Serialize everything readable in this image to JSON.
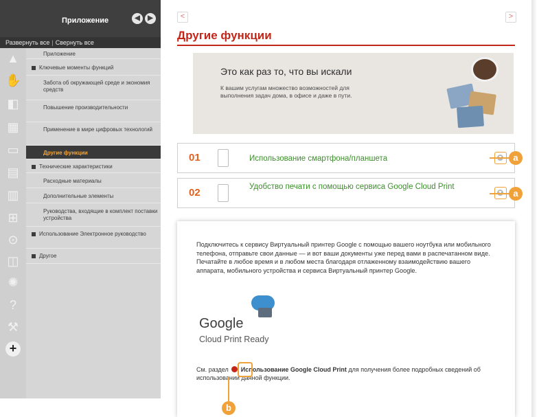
{
  "sidebar": {
    "title": "Приложение",
    "prev_icon": "◀",
    "next_icon": "▶",
    "expand_all": "Развернуть все",
    "collapse_all": "Свернуть все",
    "separator": "|",
    "items": [
      {
        "label": "Приложение",
        "level": 0
      },
      {
        "label": "Ключевые моменты функций",
        "level": 0,
        "expandable": true
      },
      {
        "label": "Забота об окружающей среде и экономия средств",
        "level": 1
      },
      {
        "label": "Повышение производительности",
        "level": 1
      },
      {
        "label": "Применение в мире цифровых технологий",
        "level": 1
      },
      {
        "label": "Другие функции",
        "level": 1,
        "active": true
      },
      {
        "label": "Технические характеристики",
        "level": 0,
        "expandable": true
      },
      {
        "label": "Расходные материалы",
        "level": 0
      },
      {
        "label": "Дополнительные элементы",
        "level": 0
      },
      {
        "label": "Руководства, входящие в комплект поставки устройства",
        "level": 0
      },
      {
        "label": "Использование Электронное руководство",
        "level": 0,
        "expandable": true
      },
      {
        "label": "Другое",
        "level": 0,
        "expandable": true
      }
    ],
    "strip_icons": [
      "warning-icon",
      "hand-icon",
      "device-icon",
      "fax-icon",
      "printer-icon",
      "scanner-icon",
      "document-icon",
      "network-icon",
      "lock-icon",
      "remote-icon",
      "gear-icon",
      "help-icon",
      "wrench-icon",
      "plus-icon"
    ]
  },
  "main": {
    "prev_page": "<",
    "next_page": ">",
    "title": "Другие функции",
    "banner": {
      "headline": "Это как раз то, что вы искали",
      "text": "К вашим услугам множество возможностей для выполнения задач дома, в офисе и даже в пути."
    },
    "features": [
      {
        "number": "01",
        "label": "Использование смартфона/планшета"
      },
      {
        "number": "02",
        "label": "Удобство печати с помощью сервиса Google Cloud Print"
      }
    ],
    "description": "Подключитесь к сервису Виртуальный принтер Google с помощью вашего ноутбука или мобильного телефона, отправьте свои данные — и вот ваши документы уже перед вами в распечатанном виде. Печатайте в любое время и в любом места благодаря отлаженному взаимодействию вашего аппарата, мобильного устройства и сервиса Виртуальный принтер Google.",
    "google_brand": "Google",
    "google_sub": "Cloud Print Ready",
    "ref_prefix": "См. раздел",
    "ref_link": "Использование Google Cloud Print",
    "ref_suffix": "для получения более подробных сведений об использовании данной функции."
  },
  "callouts": {
    "a": "a",
    "b": "b"
  }
}
